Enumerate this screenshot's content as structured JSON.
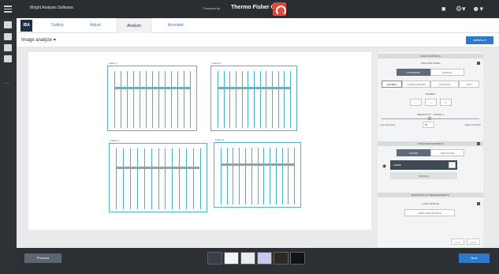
{
  "topbar": {
    "app_name": "iBright Analysis Software",
    "powered_by": "Powered by",
    "brand": "Thermo Fisher Cloud",
    "icons": [
      "menu-icon",
      "cloud-logo-icon",
      "chat-icon",
      "settings-icon",
      "user-icon"
    ]
  },
  "tabs": {
    "logo": "iBA",
    "items": [
      "Gallery",
      "Adjust",
      "Analyze",
      "Annotate"
    ],
    "active": "Analyze"
  },
  "subhead": {
    "title": "Image analyze ▾",
    "actions": "Actions ▾"
  },
  "blots": [
    {
      "label": "Frame 1",
      "lanes": 13,
      "band_row": "upper"
    },
    {
      "label": "Frame 2",
      "lanes": 13,
      "band_row": "upper"
    },
    {
      "label": "Frame 3",
      "lanes": 13,
      "band_row": "middle"
    },
    {
      "label": "Frame 4",
      "lanes": 13,
      "band_row": "upper"
    }
  ],
  "panel": {
    "scan_controls": "SCAN CONTROLS",
    "analysis_mode": "ANALYSIS MODE",
    "automatic": "AUTOMATIC",
    "manual": "MANUAL",
    "subtabs": [
      "FRAMES",
      "LANES & BANDS",
      "ANALYSIS",
      "INFO"
    ],
    "frames_label": "FRAMES",
    "sensitivity_label": "SENSITIVITY - FRAME 1",
    "sensitivity_left": "Low sensitivity",
    "sensitivity_right": "High sensitivity",
    "sensitivity_value": "50",
    "visualize_channels": "VISUALIZE CHANNELS",
    "color": "COLOR",
    "grayscale": "GRAYSCALE",
    "channel_name": "CHEMI",
    "marker_label": "MARKER",
    "band_display": "BAND DISPLAY MEASUREMENTS",
    "lane_profile": "LANE PROFILE",
    "view_lane_profile": "VIEW LANE PROFILE",
    "undo": "Undo",
    "redo": "Redo"
  },
  "bottom": {
    "previous": "Previous",
    "next": "Next",
    "thumb_colors": [
      "#3a3f45",
      "#f4f4f4",
      "#eaeaea",
      "#c7c9ef",
      "#2b2a1c",
      "#111214"
    ]
  }
}
